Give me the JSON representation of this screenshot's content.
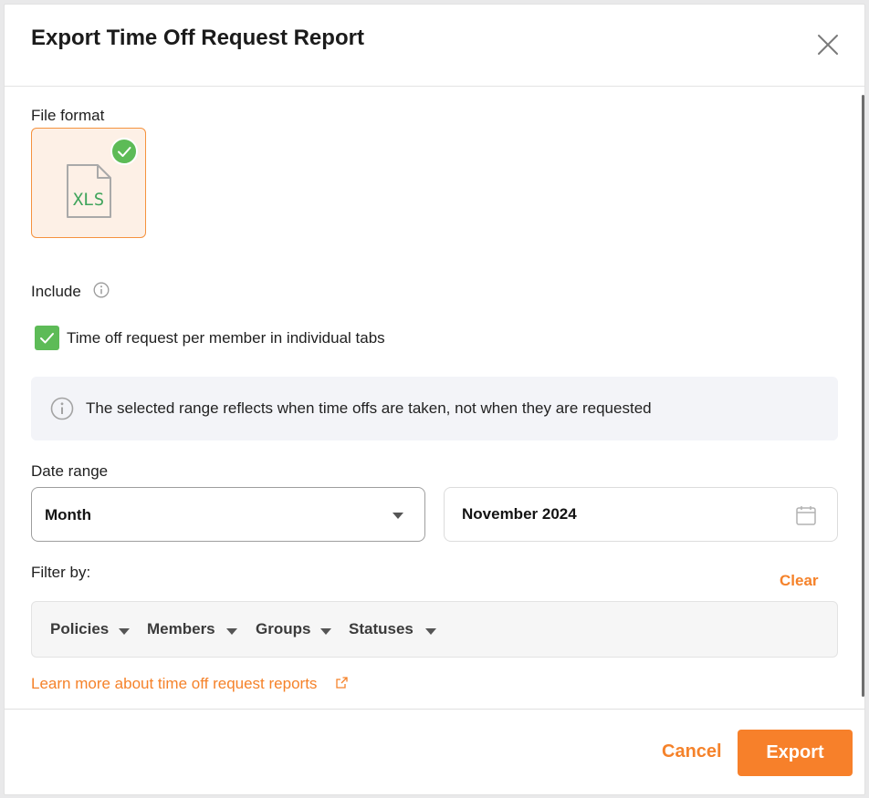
{
  "dialog": {
    "title": "Export Time Off Request Report",
    "close_icon": "close-icon"
  },
  "file_format": {
    "label": "File format",
    "options": [
      {
        "name": "XLS",
        "selected": true,
        "icon": "xls-file-icon"
      }
    ]
  },
  "include": {
    "label": "Include",
    "info_icon": "info-icon",
    "options": [
      {
        "label": "Time off request per member in individual tabs",
        "checked": true
      }
    ]
  },
  "notice": {
    "icon": "info-icon",
    "text": "The selected range reflects when time offs are taken, not when they are requested"
  },
  "date_range": {
    "label": "Date range",
    "period": "Month",
    "value": "November 2024",
    "calendar_icon": "calendar-icon"
  },
  "filter": {
    "label": "Filter by:",
    "clear_label": "Clear",
    "items": [
      {
        "label": "Policies"
      },
      {
        "label": "Members"
      },
      {
        "label": "Groups"
      },
      {
        "label": "Statuses"
      }
    ]
  },
  "learn_more": {
    "label": "Learn more about time off request reports",
    "icon": "external-link-icon"
  },
  "footer": {
    "cancel_label": "Cancel",
    "export_label": "Export"
  },
  "colors": {
    "accent": "#f7802a",
    "success": "#5dbb57",
    "selected_bg": "#fdf0e6"
  }
}
